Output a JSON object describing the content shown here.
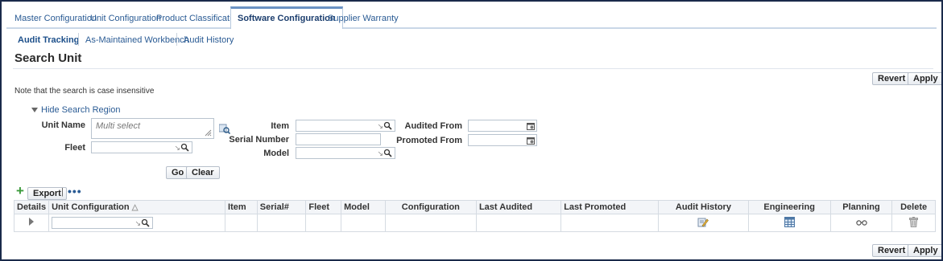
{
  "tabs": [
    {
      "label": "Master Configuration",
      "active": false
    },
    {
      "label": "Unit Configuration",
      "active": false
    },
    {
      "label": "Product Classification",
      "active": false
    },
    {
      "label": "Software Configuration",
      "active": true
    },
    {
      "label": "Supplier Warranty",
      "active": false
    }
  ],
  "subtabs": [
    {
      "label": "Audit Tracking",
      "active": true
    },
    {
      "label": "As-Maintained Workbench",
      "active": false
    },
    {
      "label": "Audit History",
      "active": false
    }
  ],
  "page_title": "Search Unit",
  "buttons": {
    "revert": "Revert",
    "apply": "Apply",
    "go": "Go",
    "clear": "Clear",
    "export": "Export"
  },
  "note": "Note that the search is case insensitive",
  "hide_search_region": "Hide Search Region",
  "search": {
    "unit_name_label": "Unit Name",
    "unit_name_placeholder": "Multi select",
    "fleet_label": "Fleet",
    "item_label": "Item",
    "serial_number_label": "Serial Number",
    "model_label": "Model",
    "audited_from_label": "Audited From",
    "promoted_from_label": "Promoted From"
  },
  "table": {
    "columns": [
      "Details",
      "Unit Configuration",
      "Item",
      "Serial#",
      "Fleet",
      "Model",
      "Configuration",
      "Last Audited",
      "Last Promoted",
      "Audit History",
      "Engineering",
      "Planning",
      "Delete"
    ]
  },
  "icons": {
    "search": "search-icon",
    "calendar": "calendar-icon",
    "audit_history": "edit-icon",
    "engineering": "spreadsheet-icon",
    "planning": "glasses-icon",
    "delete": "trash-icon"
  }
}
